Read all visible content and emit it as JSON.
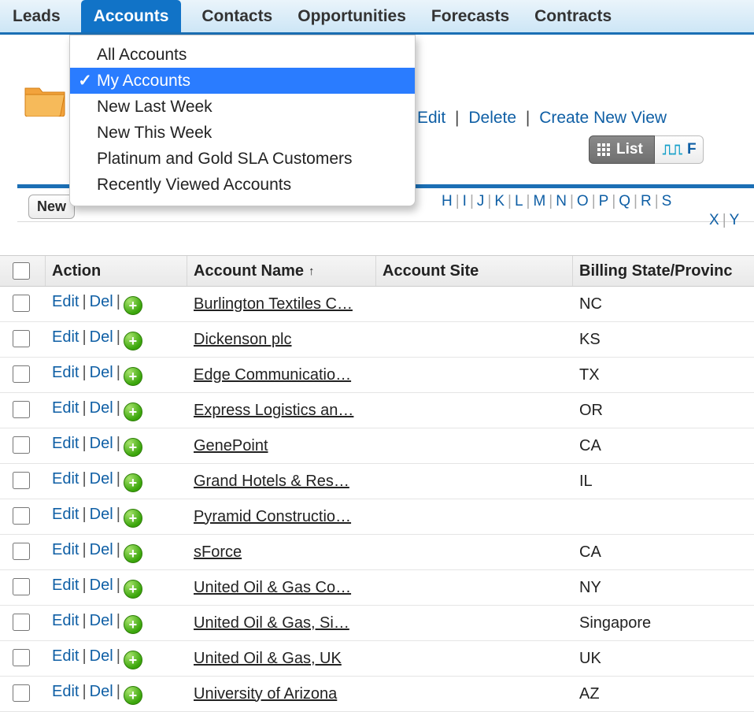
{
  "tabs": {
    "items": [
      "Leads",
      "Accounts",
      "Contacts",
      "Opportunities",
      "Forecasts",
      "Contracts"
    ],
    "active_index": 1
  },
  "dropdown": {
    "items": [
      "All Accounts",
      "My Accounts",
      "New Last Week",
      "New This Week",
      "Platinum and Gold SLA Customers",
      "Recently Viewed Accounts"
    ],
    "selected_index": 1
  },
  "view_actions": {
    "edit": "Edit",
    "delete": "Delete",
    "create": "Create New View"
  },
  "view_buttons": {
    "list": "List",
    "feed_letter": "F"
  },
  "list_toolbar": {
    "new_truncated": "New"
  },
  "alpha_row1": [
    "H",
    "I",
    "J",
    "K",
    "L",
    "M",
    "N",
    "O",
    "P",
    "Q",
    "R",
    "S"
  ],
  "alpha_row2": [
    "X",
    "Y"
  ],
  "columns": {
    "action": "Action",
    "name": "Account Name",
    "site": "Account Site",
    "billing": "Billing State/Provinc"
  },
  "row_action_labels": {
    "edit": "Edit",
    "del": "Del"
  },
  "rows": [
    {
      "name": "Burlington Textiles C…",
      "site": "",
      "billing": "NC"
    },
    {
      "name": "Dickenson plc",
      "site": "",
      "billing": "KS"
    },
    {
      "name": "Edge Communicatio…",
      "site": "",
      "billing": "TX"
    },
    {
      "name": "Express Logistics an…",
      "site": "",
      "billing": "OR"
    },
    {
      "name": "GenePoint",
      "site": "",
      "billing": "CA"
    },
    {
      "name": "Grand Hotels & Res…",
      "site": "",
      "billing": "IL"
    },
    {
      "name": "Pyramid Constructio…",
      "site": "",
      "billing": ""
    },
    {
      "name": "sForce",
      "site": "",
      "billing": "CA"
    },
    {
      "name": "United Oil & Gas Co…",
      "site": "",
      "billing": "NY"
    },
    {
      "name": "United Oil & Gas, Si…",
      "site": "",
      "billing": "Singapore"
    },
    {
      "name": "United Oil & Gas, UK",
      "site": "",
      "billing": "UK"
    },
    {
      "name": "University of Arizona",
      "site": "",
      "billing": "AZ"
    }
  ]
}
